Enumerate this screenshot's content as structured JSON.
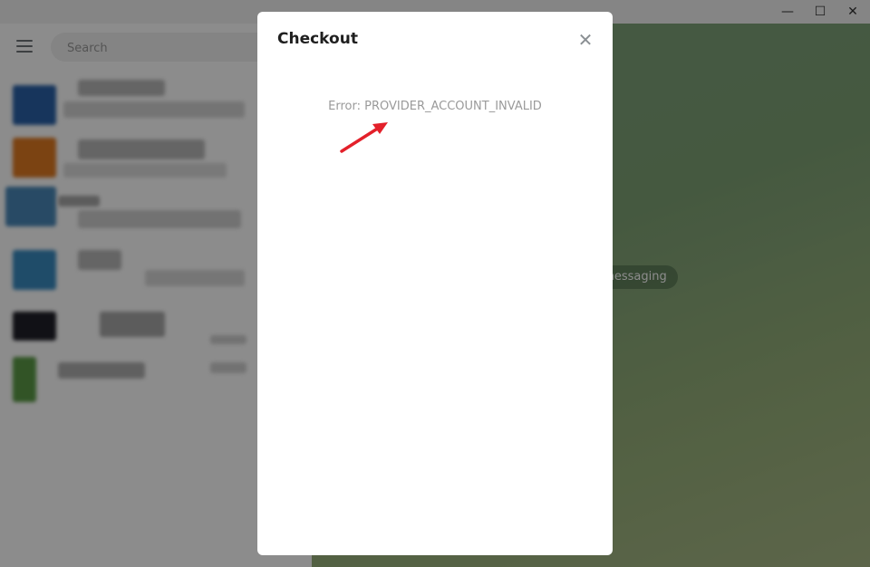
{
  "window": {
    "controls": {
      "minimize": "—",
      "maximize": "☐",
      "close": "✕"
    }
  },
  "sidebar": {
    "search_placeholder": "Search"
  },
  "main": {
    "hint": "t messaging"
  },
  "modal": {
    "title": "Checkout",
    "close_glyph": "✕",
    "error": "Error: PROVIDER_ACCOUNT_INVALID"
  },
  "colors": {
    "annotation_arrow": "#e3202a",
    "chat_background": "#7fa37b",
    "title_text": "#1f1f1f",
    "error_text": "#9a9a9a"
  }
}
